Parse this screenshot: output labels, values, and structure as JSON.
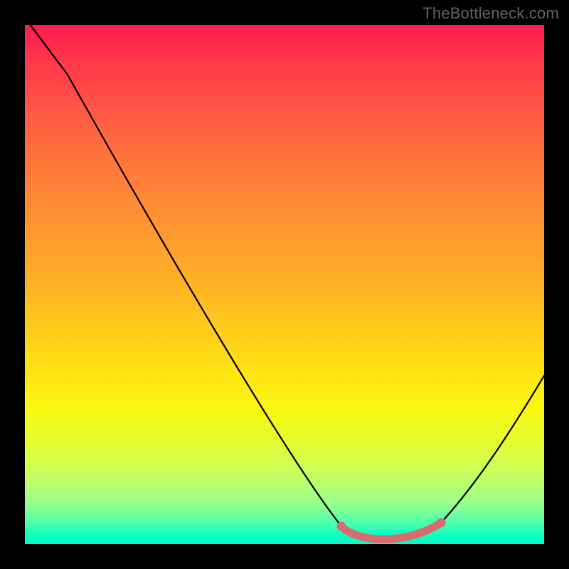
{
  "watermark": "TheBottleneck.com",
  "chart_data": {
    "type": "line",
    "title": "",
    "xlabel": "",
    "ylabel": "",
    "axes_visible": false,
    "x_range_estimate": [
      0,
      100
    ],
    "y_range_estimate": [
      0,
      100
    ],
    "background": {
      "kind": "vertical-gradient",
      "stops": [
        {
          "pos": 0.0,
          "color": "#ff1a50"
        },
        {
          "pos": 0.5,
          "color": "#ffb225"
        },
        {
          "pos": 0.74,
          "color": "#f9f710"
        },
        {
          "pos": 1.0,
          "color": "#00ffc8"
        }
      ],
      "semantics": "top=red=bad, bottom=green=good"
    },
    "series": [
      {
        "name": "bottleneck-curve",
        "color": "#000000",
        "approx_points_xy": [
          [
            0,
            100
          ],
          [
            8,
            90
          ],
          [
            27,
            56
          ],
          [
            51,
            16
          ],
          [
            61,
            3
          ],
          [
            70,
            0
          ],
          [
            80,
            4
          ],
          [
            100,
            33
          ]
        ],
        "note": "values estimated from pixel positions; y=0 is bottom (best)"
      }
    ],
    "highlight_segment": {
      "name": "sweet-spot",
      "color": "#d96a6d",
      "x_range_estimate": [
        61,
        80
      ],
      "y_value_estimate": 0,
      "endpoints_marked": true
    },
    "watermark": "TheBottleneck.com"
  }
}
